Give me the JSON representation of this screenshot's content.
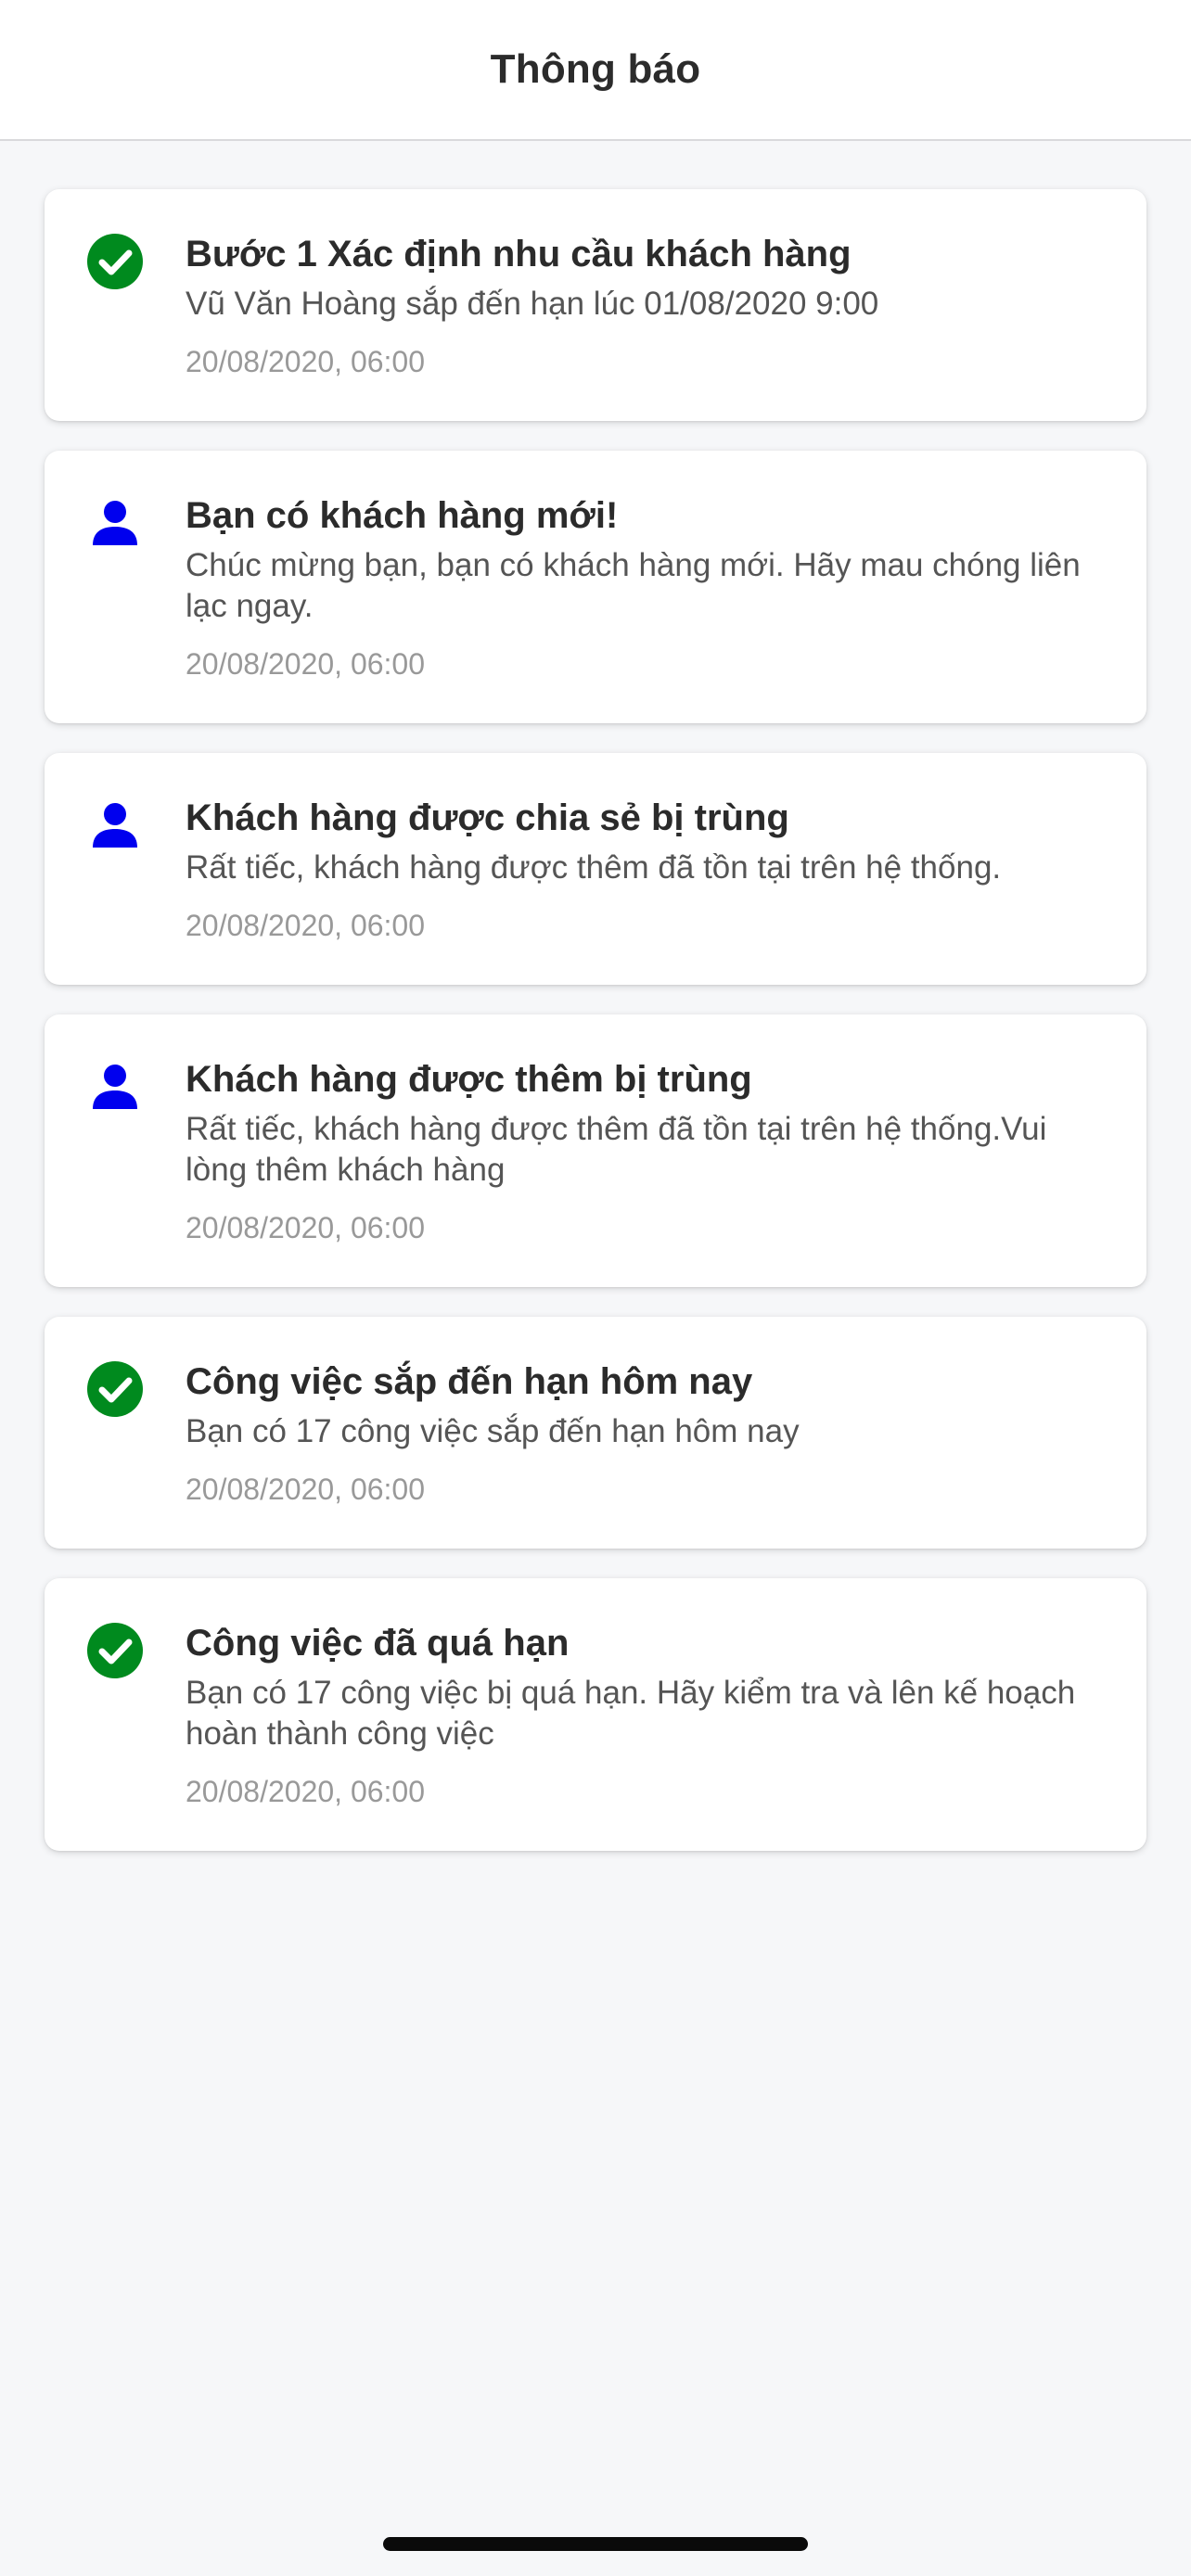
{
  "header": {
    "title": "Thông báo"
  },
  "colors": {
    "success_green": "#008a1e",
    "user_blue": "#0000ee"
  },
  "notifications": [
    {
      "icon": "check-circle-icon",
      "title": "Bước 1 Xác định nhu cầu khách hàng",
      "message": "Vũ Văn Hoàng sắp đến hạn lúc 01/08/2020 9:00",
      "time": "20/08/2020, 06:00"
    },
    {
      "icon": "user-icon",
      "title": "Bạn có khách hàng mới!",
      "message": "Chúc mừng bạn, bạn có khách hàng mới. Hãy mau chóng liên lạc ngay.",
      "time": "20/08/2020, 06:00"
    },
    {
      "icon": "user-icon",
      "title": "Khách hàng được chia sẻ bị trùng",
      "message": "Rất tiếc, khách hàng được thêm đã tồn tại trên hệ thống.",
      "time": "20/08/2020, 06:00"
    },
    {
      "icon": "user-icon",
      "title": "Khách hàng được thêm bị trùng",
      "message": "Rất tiếc, khách hàng được thêm đã tồn tại trên hệ thống.Vui lòng thêm khách hàng",
      "time": "20/08/2020, 06:00"
    },
    {
      "icon": "check-circle-icon",
      "title": "Công việc sắp đến hạn hôm nay",
      "message": "Bạn có 17 công việc sắp đến hạn hôm nay",
      "time": "20/08/2020, 06:00"
    },
    {
      "icon": "check-circle-icon",
      "title": "Công việc đã quá hạn",
      "message": "Bạn có 17 công việc bị quá hạn. Hãy kiểm tra và lên kế hoạch hoàn thành công việc",
      "time": "20/08/2020, 06:00"
    }
  ]
}
